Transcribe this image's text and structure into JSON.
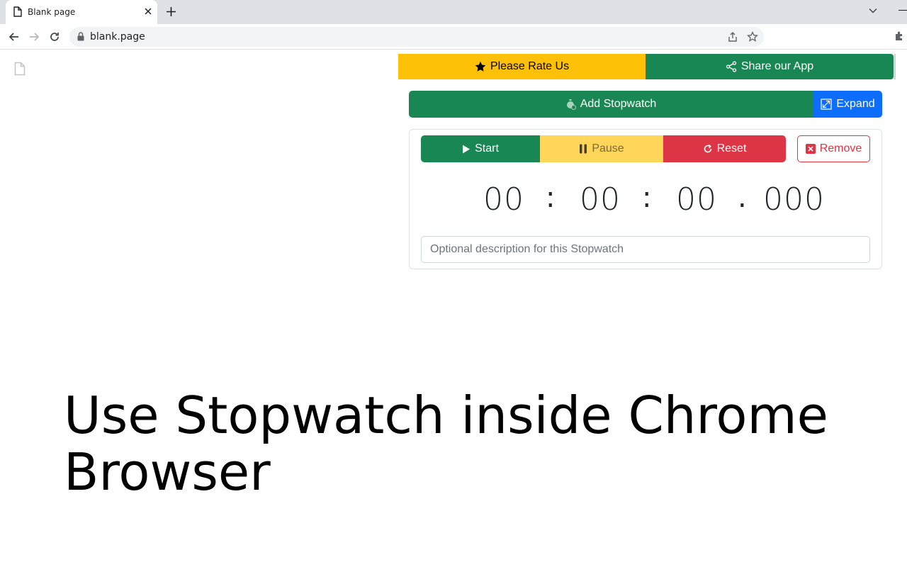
{
  "browser": {
    "tab_title": "Blank page",
    "url": "blank.page"
  },
  "popup": {
    "rate_label": "Please Rate Us",
    "share_label": "Share our App",
    "add_label": "Add Stopwatch",
    "expand_label": "Expand",
    "stopwatch": {
      "start_label": "Start",
      "pause_label": "Pause",
      "reset_label": "Reset",
      "remove_label": "Remove",
      "hours": "00",
      "minutes": "00",
      "seconds": "00",
      "millis": "000",
      "sep1": ":",
      "sep2": ":",
      "sep3": ".",
      "description_placeholder": "Optional description for this Stopwatch"
    }
  },
  "headline": "Use Stopwatch inside Chrome Browser",
  "colors": {
    "rate": "#ffc107",
    "success": "#198754",
    "primary": "#0d6efd",
    "warning": "#ffd65a",
    "danger": "#dc3545"
  }
}
